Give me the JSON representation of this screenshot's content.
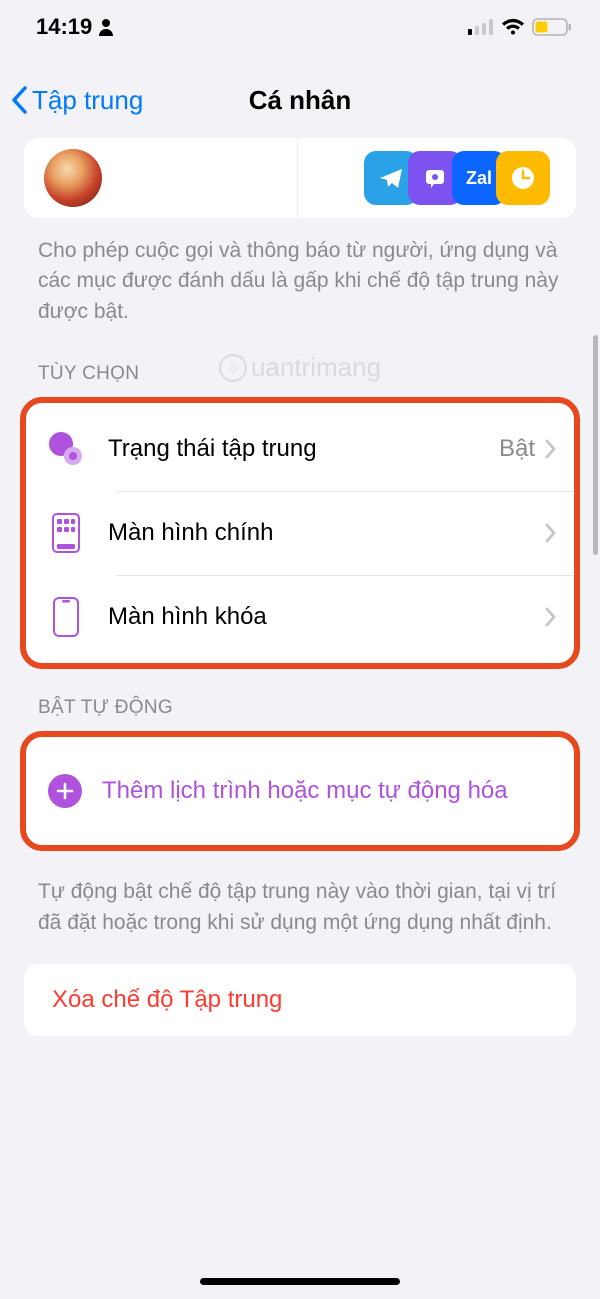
{
  "status": {
    "time": "14:19"
  },
  "nav": {
    "back": "Tập trung",
    "title": "Cá nhân"
  },
  "allowed_desc": "Cho phép cuộc gọi và thông báo từ người, ứng dụng và các mục được đánh dấu là gấp khi chế độ tập trung này được bật.",
  "watermark": "uantrimang",
  "sections": {
    "options_header": "TÙY CHỌN",
    "auto_header": "BẬT TỰ ĐỘNG"
  },
  "rows": {
    "focus_status": {
      "label": "Trạng thái tập trung",
      "value": "Bật"
    },
    "home_screen": {
      "label": "Màn hình chính"
    },
    "lock_screen": {
      "label": "Màn hình khóa"
    }
  },
  "add_schedule": "Thêm lịch trình hoặc mục tự động hóa",
  "auto_desc": "Tự động bật chế độ tập trung này vào thời gian, tại vị trí đã đặt hoặc trong khi sử dụng một ứng dụng nhất định.",
  "delete": "Xóa chế độ Tập trung",
  "app_icons": {
    "zalo": "Zal"
  }
}
